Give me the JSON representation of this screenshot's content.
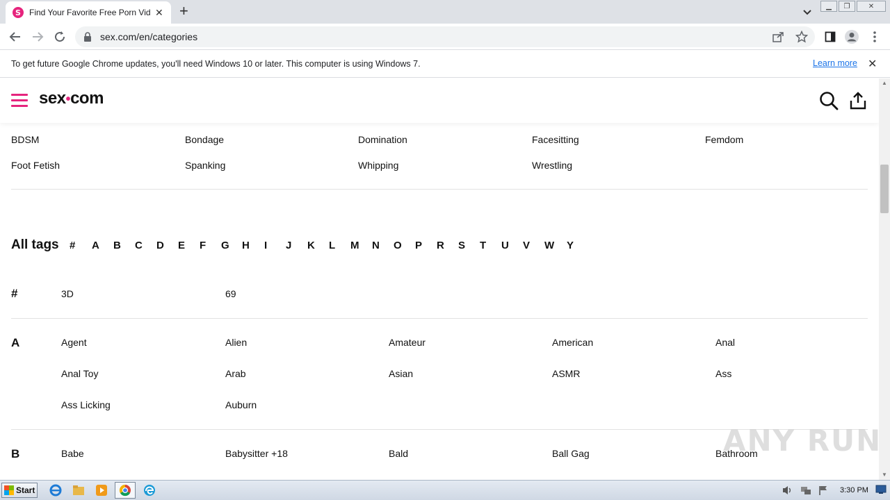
{
  "browser": {
    "tab_title": "Find Your Favorite Free Porn Videos",
    "favicon_letter": "S",
    "url": "sex.com/en/categories",
    "window_controls": [
      "minimize",
      "restore",
      "close"
    ]
  },
  "infobar": {
    "message": "To get future Google Chrome updates, you'll need Windows 10 or later. This computer is using Windows 7.",
    "link": "Learn more"
  },
  "site": {
    "logo_left": "sex",
    "logo_right": "com",
    "accent_color": "#e6247d"
  },
  "fetish_categories": {
    "row1": [
      "BDSM",
      "Bondage",
      "Domination",
      "Facesitting",
      "Femdom"
    ],
    "row2": [
      "Foot Fetish",
      "Spanking",
      "Whipping",
      "Wrestling"
    ]
  },
  "all_tags": {
    "title": "All tags",
    "letters": [
      "#",
      "A",
      "B",
      "C",
      "D",
      "E",
      "F",
      "G",
      "H",
      "I",
      "J",
      "K",
      "L",
      "M",
      "N",
      "O",
      "P",
      "R",
      "S",
      "T",
      "U",
      "V",
      "W",
      "Y"
    ]
  },
  "sections": {
    "hash": {
      "letter": "#",
      "tags": [
        "3D",
        "69"
      ]
    },
    "a": {
      "letter": "A",
      "tags": [
        "Agent",
        "Alien",
        "Amateur",
        "American",
        "Anal",
        "Anal Toy",
        "Arab",
        "Asian",
        "ASMR",
        "Ass",
        "Ass Licking",
        "Auburn"
      ]
    },
    "b": {
      "letter": "B",
      "tags": [
        "Babe",
        "Babysitter +18",
        "Bald",
        "Ball Gag",
        "Bathroom"
      ]
    }
  },
  "watermark": "ANY RUN",
  "taskbar": {
    "start_label": "Start",
    "clock": "3:30 PM"
  }
}
